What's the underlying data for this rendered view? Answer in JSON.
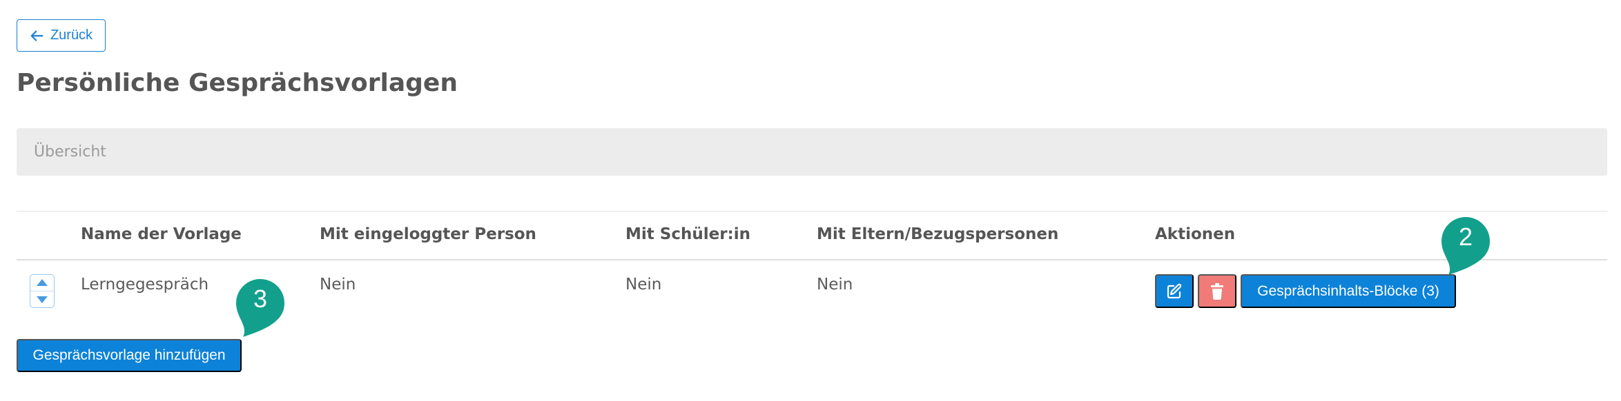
{
  "nav": {
    "back_label": "Zurück"
  },
  "page": {
    "title": "Persönliche Gesprächsvorlagen"
  },
  "overview": {
    "label": "Übersicht"
  },
  "table": {
    "headers": [
      "Name der Vorlage",
      "Mit eingeloggter Person",
      "Mit Schüler:in",
      "Mit Eltern/Bezugspersonen",
      "Aktionen"
    ],
    "rows": [
      {
        "name": "Lerngegespräch",
        "with_logged_in_person": "Nein",
        "with_student": "Nein",
        "with_parents": "Nein",
        "blocks_label": "Gesprächsinhalts-Blöcke (3)"
      }
    ]
  },
  "actions": {
    "add_label": "Gesprächsvorlage hinzufügen"
  },
  "markers": [
    "2",
    "3"
  ],
  "colors": {
    "primary": "#0d82d9",
    "danger": "#f07b78",
    "marker": "#12a08c",
    "overview_bg": "#ececec"
  },
  "icons": {
    "back": "arrow-left-icon",
    "edit": "edit-icon",
    "delete": "trash-icon",
    "sort": "sort-arrows-icon"
  }
}
